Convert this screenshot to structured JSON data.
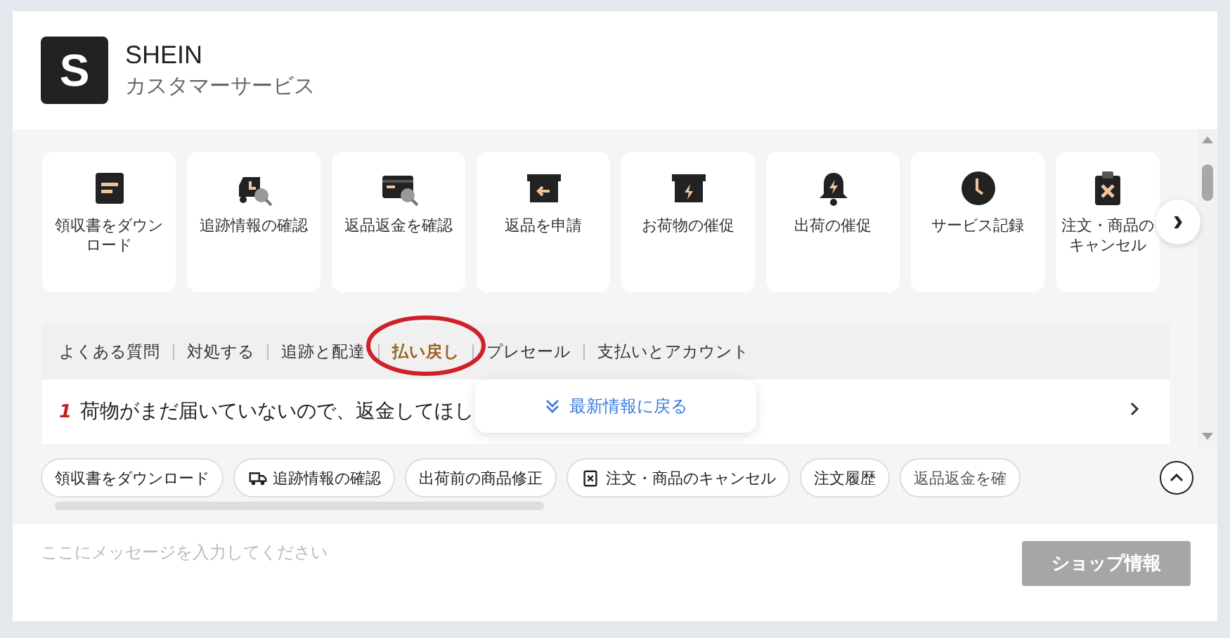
{
  "header": {
    "logo": "S",
    "brand": "SHEIN",
    "subtitle": "カスタマーサービス"
  },
  "shortcuts": [
    {
      "label": "領収書をダウンロード"
    },
    {
      "label": "追跡情報の確認"
    },
    {
      "label": "返品返金を確認"
    },
    {
      "label": "返品を申請"
    },
    {
      "label": "お荷物の催促"
    },
    {
      "label": "出荷の催促"
    },
    {
      "label": "サービス記録"
    },
    {
      "label": "注文・商品のキャンセル"
    }
  ],
  "next_button": "›",
  "tabs": [
    {
      "label": "よくある質問",
      "selected": false
    },
    {
      "label": "対処する",
      "selected": false
    },
    {
      "label": "追跡と配達",
      "selected": false
    },
    {
      "label": "払い戻し",
      "selected": true
    },
    {
      "label": "プレセール",
      "selected": false
    },
    {
      "label": "支払いとアカウント",
      "selected": false
    }
  ],
  "questions": [
    {
      "number": "1",
      "text": "荷物がまだ届いていないので、返金してほし"
    }
  ],
  "latest_popup": "最新情報に戻る",
  "chips": [
    {
      "label": "領収書をダウンロード",
      "kind": "plain"
    },
    {
      "label": "追跡情報の確認",
      "kind": "truck"
    },
    {
      "label": "出荷前の商品修正",
      "kind": "plain"
    },
    {
      "label": "注文・商品のキャンセル",
      "kind": "cancel"
    },
    {
      "label": "注文履歴",
      "kind": "plain"
    },
    {
      "label": "返品返金を確",
      "kind": "plain"
    }
  ],
  "composer": {
    "placeholder": "ここにメッセージを入力してください",
    "button": "ショップ情報",
    "button_disabled": true
  }
}
